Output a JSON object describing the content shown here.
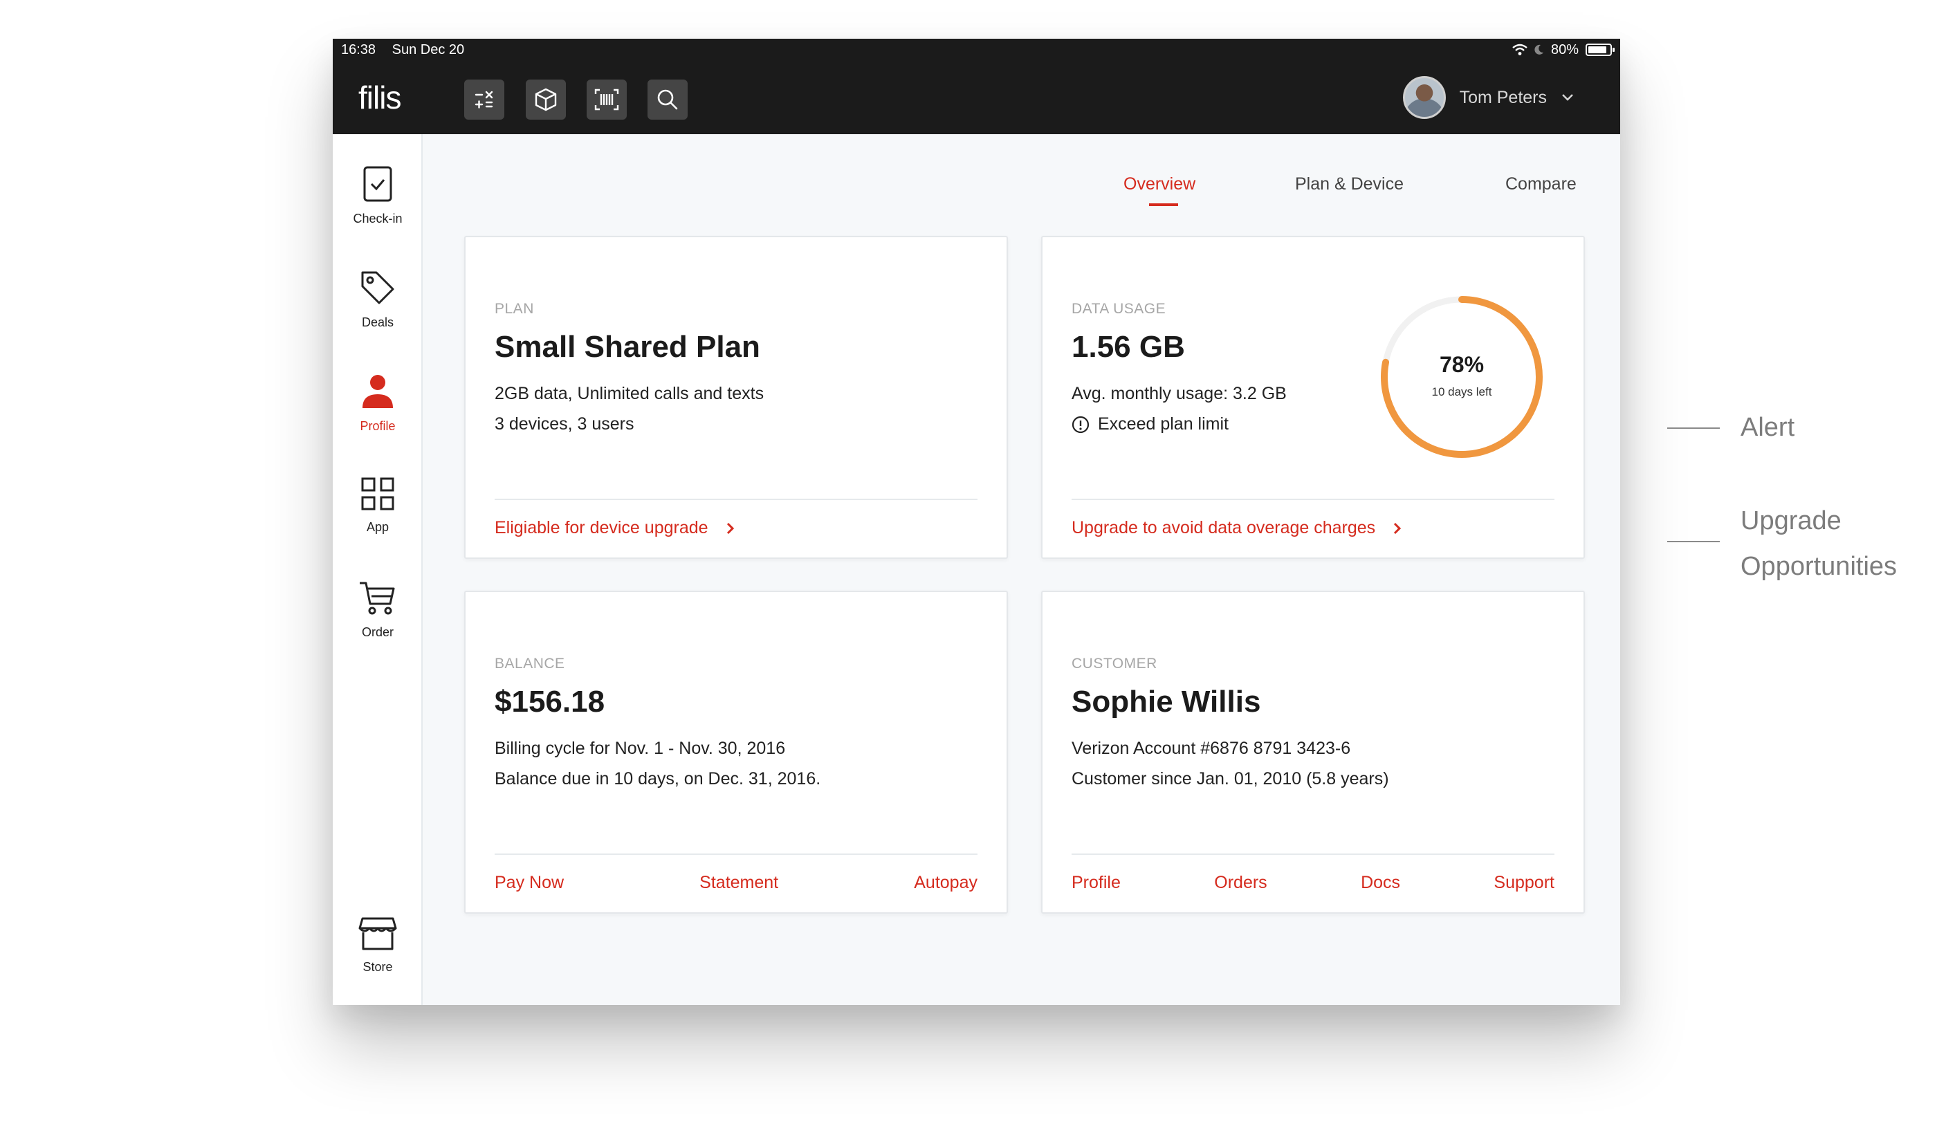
{
  "status_bar": {
    "time": "16:38",
    "date": "Sun Dec 20",
    "battery": "80%"
  },
  "app": {
    "logo": "filis"
  },
  "toolbar": {
    "icons": [
      "calculator-icon",
      "package-icon",
      "barcode-icon",
      "search-icon"
    ]
  },
  "user": {
    "name": "Tom Peters"
  },
  "sidebar": {
    "items": [
      {
        "label": "Check-in",
        "icon": "checkin-icon"
      },
      {
        "label": "Deals",
        "icon": "tag-icon"
      },
      {
        "label": "Profile",
        "icon": "person-icon",
        "active": true
      },
      {
        "label": "App",
        "icon": "grid-icon"
      },
      {
        "label": "Order",
        "icon": "cart-icon"
      },
      {
        "label": "Store",
        "icon": "store-icon"
      }
    ]
  },
  "tabs": [
    {
      "label": "Overview",
      "active": true
    },
    {
      "label": "Plan & Device"
    },
    {
      "label": "Compare"
    }
  ],
  "plan_card": {
    "label": "PLAN",
    "title": "Small Shared Plan",
    "line1": "2GB data, Unlimited calls and texts",
    "line2": "3 devices, 3 users",
    "link": "Eligiable for device upgrade"
  },
  "data_card": {
    "label": "DATA USAGE",
    "title": "1.56 GB",
    "line1": "Avg. monthly usage: 3.2 GB",
    "line2": "Exceed plan limit",
    "gauge_percent": "78%",
    "gauge_value": 0.78,
    "gauge_sub": "10 days left",
    "link": "Upgrade to avoid data overage charges"
  },
  "balance_card": {
    "label": "BALANCE",
    "title": "$156.18",
    "line1": "Billing cycle for Nov. 1 - Nov. 30, 2016",
    "line2": "Balance due in 10 days, on Dec. 31, 2016.",
    "actions": [
      "Pay Now",
      "Statement",
      "Autopay"
    ]
  },
  "customer_card": {
    "label": "CUSTOMER",
    "title": "Sophie Willis",
    "line1": "Verizon Account #6876 8791 3423-6",
    "line2": "Customer since Jan. 01, 2010 (5.8 years)",
    "actions": [
      "Profile",
      "Orders",
      "Docs",
      "Support"
    ]
  },
  "annotations": {
    "alert": "Alert",
    "upgrade_line1": "Upgrade",
    "upgrade_line2": "Opportunities"
  },
  "colors": {
    "accent": "#d52b1e",
    "gauge": "#f0973f",
    "appbar": "#1b1b1b"
  }
}
